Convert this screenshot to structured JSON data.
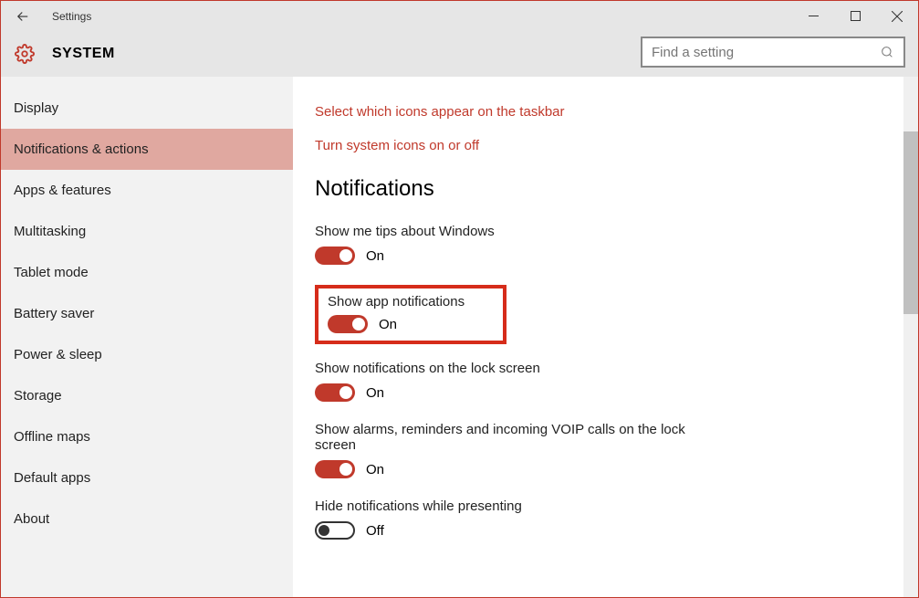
{
  "window": {
    "title": "Settings"
  },
  "header": {
    "title": "SYSTEM",
    "search_placeholder": "Find a setting"
  },
  "sidebar": {
    "items": [
      {
        "label": "Display",
        "active": false
      },
      {
        "label": "Notifications & actions",
        "active": true
      },
      {
        "label": "Apps & features",
        "active": false
      },
      {
        "label": "Multitasking",
        "active": false
      },
      {
        "label": "Tablet mode",
        "active": false
      },
      {
        "label": "Battery saver",
        "active": false
      },
      {
        "label": "Power & sleep",
        "active": false
      },
      {
        "label": "Storage",
        "active": false
      },
      {
        "label": "Offline maps",
        "active": false
      },
      {
        "label": "Default apps",
        "active": false
      },
      {
        "label": "About",
        "active": false
      }
    ]
  },
  "main": {
    "link_taskbar_icons": "Select which icons appear on the taskbar",
    "link_system_icons": "Turn system icons on or off",
    "section_title": "Notifications",
    "settings": {
      "tips": {
        "label": "Show me tips about Windows",
        "state": "On",
        "on": true
      },
      "app_notifications": {
        "label": "Show app notifications",
        "state": "On",
        "on": true,
        "highlighted": true
      },
      "lock_screen": {
        "label": "Show notifications on the lock screen",
        "state": "On",
        "on": true
      },
      "voip": {
        "label": "Show alarms, reminders and incoming VOIP calls on the lock screen",
        "state": "On",
        "on": true
      },
      "presenting": {
        "label": "Hide notifications while presenting",
        "state": "Off",
        "on": false
      }
    }
  }
}
